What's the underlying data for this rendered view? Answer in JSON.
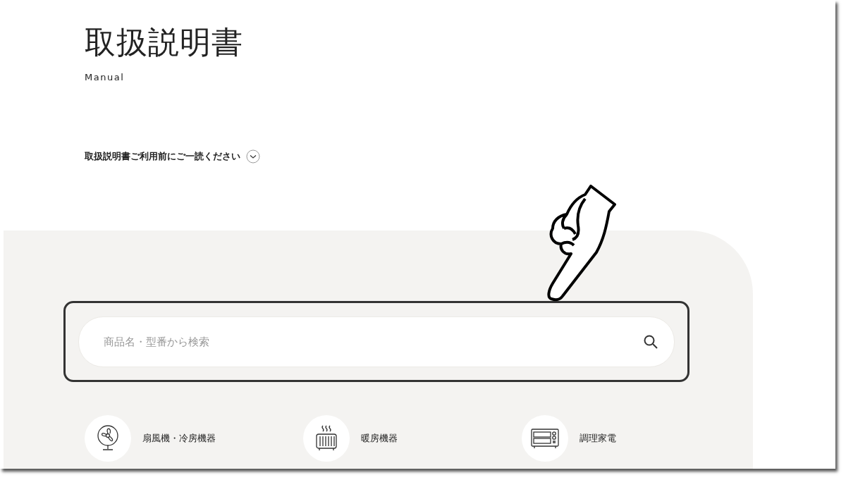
{
  "header": {
    "title": "取扱説明書",
    "subtitle": "Manual"
  },
  "notice": {
    "label": "取扱説明書ご利用前にご一読ください",
    "expanded": false
  },
  "search": {
    "placeholder": "商品名・型番から検索"
  },
  "categories": [
    {
      "kind": "fan",
      "label": "扇風機・冷房機器"
    },
    {
      "kind": "heater",
      "label": "暖房機器"
    },
    {
      "kind": "oven",
      "label": "調理家電"
    }
  ]
}
